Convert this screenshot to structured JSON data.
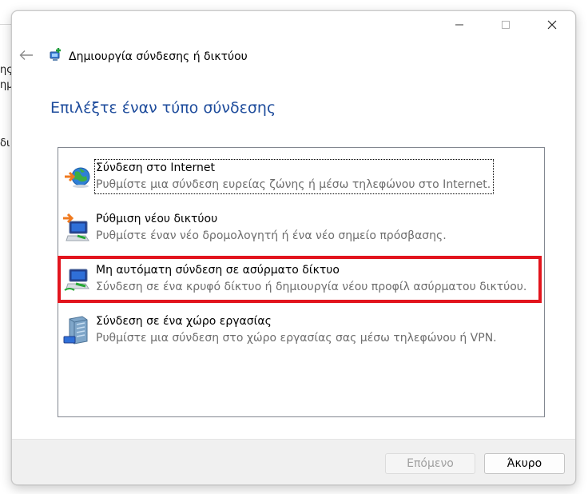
{
  "background": {
    "fragments": [
      "ης,",
      "ημ",
      "δι"
    ]
  },
  "window": {
    "title": "Δημιουργία σύνδεσης ή δικτύου",
    "title_icon": "network-connection-icon",
    "back_icon": "back-arrow-icon"
  },
  "heading": "Επιλέξτε έναν τύπο σύνδεσης",
  "options": [
    {
      "title": "Σύνδεση στο Internet",
      "description": "Ρυθμίστε μια σύνδεση ευρείας ζώνης ή μέσω τηλεφώνου στο Internet.",
      "icon": "globe-connection-icon",
      "focused": true
    },
    {
      "title": "Ρύθμιση νέου δικτύου",
      "description": "Ρυθμίστε έναν νέο δρομολογητή ή ένα νέο σημείο πρόσβασης.",
      "icon": "new-network-icon"
    },
    {
      "title": "Μη αυτόματη σύνδεση σε ασύρματο δίκτυο",
      "description": "Σύνδεση σε ένα κρυφό δίκτυο ή δημιουργία νέου προφίλ ασύρματου δικτύου.",
      "icon": "wireless-network-icon",
      "highlighted": true,
      "highlight_color": "#e2141d"
    },
    {
      "title": "Σύνδεση σε ένα χώρο εργασίας",
      "description": "Ρυθμίστε μια σύνδεση στο χώρο εργασίας σας μέσω τηλεφώνου ή VPN.",
      "icon": "workplace-connection-icon"
    }
  ],
  "footer": {
    "next_label": "Επόμενο",
    "next_enabled": false,
    "cancel_label": "Άκυρο"
  },
  "colors": {
    "heading": "#1e4c9c",
    "highlight": "#e2141d",
    "description": "#6d6d6d"
  }
}
